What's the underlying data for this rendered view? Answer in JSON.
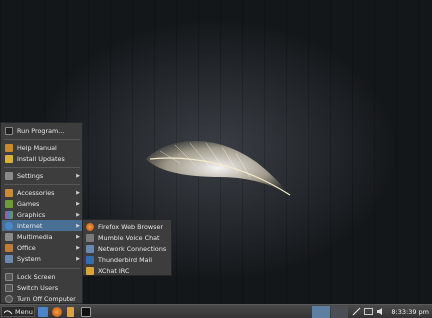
{
  "menu": {
    "items": [
      {
        "label": "Run Program...",
        "icon": "run-icon",
        "color": "#222222"
      },
      {
        "label": "Help Manual",
        "icon": "help-icon",
        "color": "#c58a2a"
      },
      {
        "label": "Install Updates",
        "icon": "updates-icon",
        "color": "#d9b13a"
      },
      {
        "label": "Settings",
        "icon": "settings-icon",
        "color": "#8a8a8a"
      },
      {
        "label": "Accessories",
        "icon": "accessories-icon",
        "color": "#c98a3a"
      },
      {
        "label": "Games",
        "icon": "games-icon",
        "color": "#6f9a3a"
      },
      {
        "label": "Graphics",
        "icon": "graphics-icon",
        "color": "#c24a8a"
      },
      {
        "label": "Internet",
        "icon": "internet-icon",
        "color": "#4a86c8"
      },
      {
        "label": "Multimedia",
        "icon": "multimedia-icon",
        "color": "#8a8a8a"
      },
      {
        "label": "Office",
        "icon": "office-icon",
        "color": "#c07b3a"
      },
      {
        "label": "System",
        "icon": "system-icon",
        "color": "#6a8ab0"
      },
      {
        "label": "Lock Screen",
        "icon": "lock-icon",
        "color": "#555555"
      },
      {
        "label": "Switch Users",
        "icon": "switch-users-icon",
        "color": "#555555"
      },
      {
        "label": "Turn Off Computer",
        "icon": "power-icon",
        "color": "#555555"
      }
    ]
  },
  "submenu": {
    "items": [
      {
        "label": "Firefox Web Browser",
        "icon": "firefox-icon",
        "color": "#e07a2a"
      },
      {
        "label": "Mumble Voice Chat",
        "icon": "mumble-icon",
        "color": "#7a7a7a"
      },
      {
        "label": "Network Connections",
        "icon": "network-icon",
        "color": "#6a8ab0"
      },
      {
        "label": "Thunderbird Mail",
        "icon": "thunderbird-icon",
        "color": "#3a6ab0"
      },
      {
        "label": "XChat IRC",
        "icon": "xchat-icon",
        "color": "#d9a53a"
      }
    ]
  },
  "taskbar": {
    "menu_label": "Menu",
    "clock": "8:33:39 pm"
  },
  "colors": {
    "highlight": "#4a6f95",
    "menu_bg": "#3d3d3d",
    "workspace_active": "#5d7fa2"
  }
}
